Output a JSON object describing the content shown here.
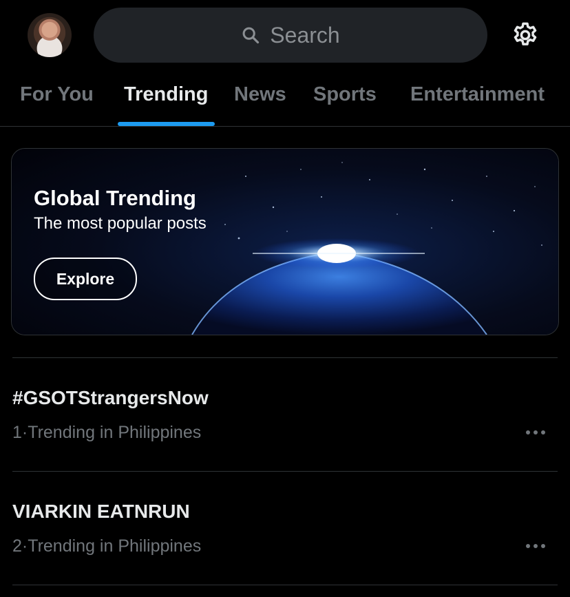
{
  "header": {
    "search_placeholder": "Search"
  },
  "tabs": [
    {
      "label": "For You"
    },
    {
      "label": "Trending"
    },
    {
      "label": "News"
    },
    {
      "label": "Sports"
    },
    {
      "label": "Entertainment"
    }
  ],
  "active_tab": "Trending",
  "banner": {
    "title": "Global Trending",
    "subtitle": "The most popular posts",
    "button_label": "Explore"
  },
  "trends": [
    {
      "name": "#GSOTStrangersNow",
      "rank": "1",
      "sep": "·",
      "context": "Trending in Philippines"
    },
    {
      "name": "VIARKIN EATNRUN",
      "rank": "2",
      "sep": "·",
      "context": "Trending in Philippines"
    }
  ],
  "colors": {
    "accent": "#1d9bf0",
    "background": "#000000",
    "muted_text": "#71767b"
  }
}
